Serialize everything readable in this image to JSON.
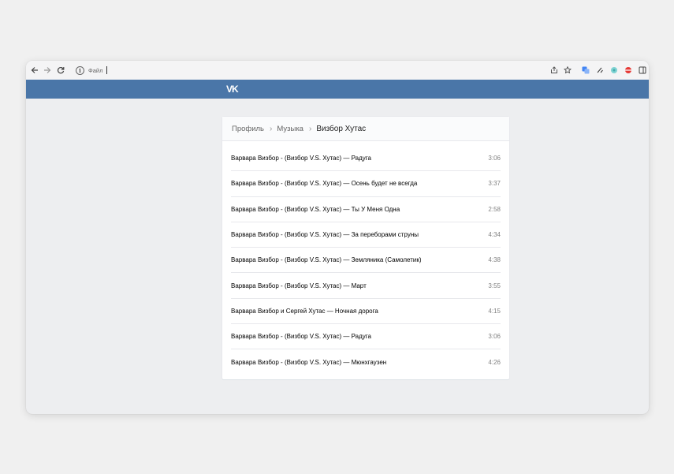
{
  "browser": {
    "address_scheme": "Файл",
    "nav_icons": [
      "back-arrow-icon",
      "forward-arrow-icon",
      "reload-icon"
    ],
    "ext_icons": [
      "share-icon",
      "star-icon",
      "translate-icon",
      "pen-icon",
      "extension-icon",
      "extension-icon",
      "sidepanel-icon"
    ]
  },
  "header": {
    "logo": "VK",
    "brand_color": "#4a76a8"
  },
  "breadcrumb": {
    "items": [
      "Профиль",
      "Музыка"
    ],
    "current": "Визбор Хутас",
    "separator": "›"
  },
  "tracks": [
    {
      "title": "Варвара Визбор - (Визбор V.S. Хутас) — Радуга",
      "duration": "3:06"
    },
    {
      "title": "Варвара Визбор - (Визбор V.S. Хутас) — Осень будет не всегда",
      "duration": "3:37"
    },
    {
      "title": "Варвара Визбор - (Визбор V.S. Хутас) — Ты У Меня Одна",
      "duration": "2:58"
    },
    {
      "title": "Варвара Визбор - (Визбор V.S. Хутас) — За переборами струны",
      "duration": "4:34"
    },
    {
      "title": "Варвара Визбор - (Визбор V.S. Хутас) — Земляника (Самолетик)",
      "duration": "4:38"
    },
    {
      "title": "Варвара Визбор - (Визбор V.S. Хутас) — Март",
      "duration": "3:55"
    },
    {
      "title": "Варвара Визбор и Сергей Хутас — Ночная дорога",
      "duration": "4:15"
    },
    {
      "title": "Варвара Визбор - (Визбор V.S. Хутас) — Радуга",
      "duration": "3:06"
    },
    {
      "title": "Варвара Визбор - (Визбор V.S. Хутас) — Мюнхгаузен",
      "duration": "4:26"
    }
  ]
}
